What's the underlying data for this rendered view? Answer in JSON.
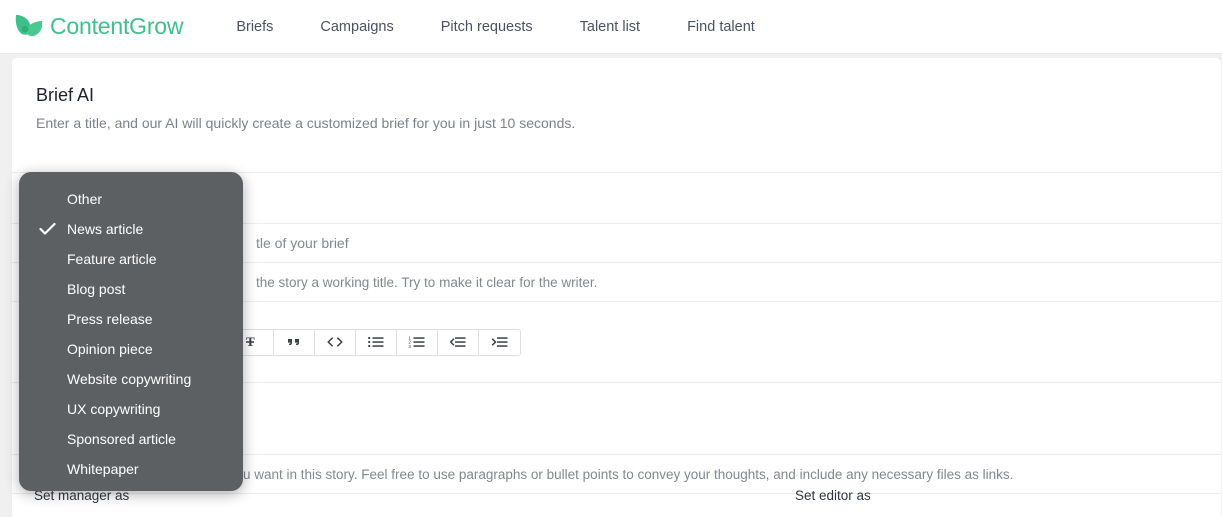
{
  "brand": {
    "name": "ContentGrow",
    "logo_icon": "leaf-logo-icon",
    "color": "#3fc08a"
  },
  "nav": {
    "items": [
      {
        "label": "Briefs"
      },
      {
        "label": "Campaigns"
      },
      {
        "label": "Pitch requests"
      },
      {
        "label": "Talent list"
      },
      {
        "label": "Find talent"
      }
    ]
  },
  "main": {
    "title": "Brief AI",
    "subtitle": "Enter a title, and our AI will quickly create a customized brief for you in just 10 seconds.",
    "title_field": {
      "placeholder": "tle of your brief",
      "hint": "the story a working title. Try to make it clear for the writer."
    },
    "body_field": {
      "hint": "u want in this story. Feel free to use paragraphs or bullet points to convey your thoughts, and include any necessary files as links."
    },
    "toolbar": {
      "buttons": [
        {
          "icon": "clear-formatting-icon",
          "label": "Clear formatting"
        },
        {
          "icon": "blockquote-icon",
          "label": "Blockquote"
        },
        {
          "icon": "code-block-icon",
          "label": "Code block"
        },
        {
          "icon": "bullet-list-icon",
          "label": "Bulleted list"
        },
        {
          "icon": "numbered-list-icon",
          "label": "Numbered list"
        },
        {
          "icon": "outdent-icon",
          "label": "Decrease indent"
        },
        {
          "icon": "indent-icon",
          "label": "Increase indent"
        }
      ]
    },
    "footer": {
      "manager_label": "Set manager as",
      "editor_label": "Set editor as"
    }
  },
  "dropdown": {
    "background": "#5c6063",
    "selected": "News article",
    "items": [
      {
        "label": "Other",
        "checked": false
      },
      {
        "label": "News article",
        "checked": true
      },
      {
        "label": "Feature article",
        "checked": false
      },
      {
        "label": "Blog post",
        "checked": false
      },
      {
        "label": "Press release",
        "checked": false
      },
      {
        "label": "Opinion piece",
        "checked": false
      },
      {
        "label": "Website copywriting",
        "checked": false
      },
      {
        "label": "UX copywriting",
        "checked": false
      },
      {
        "label": "Sponsored article",
        "checked": false
      },
      {
        "label": "Whitepaper",
        "checked": false
      }
    ]
  }
}
